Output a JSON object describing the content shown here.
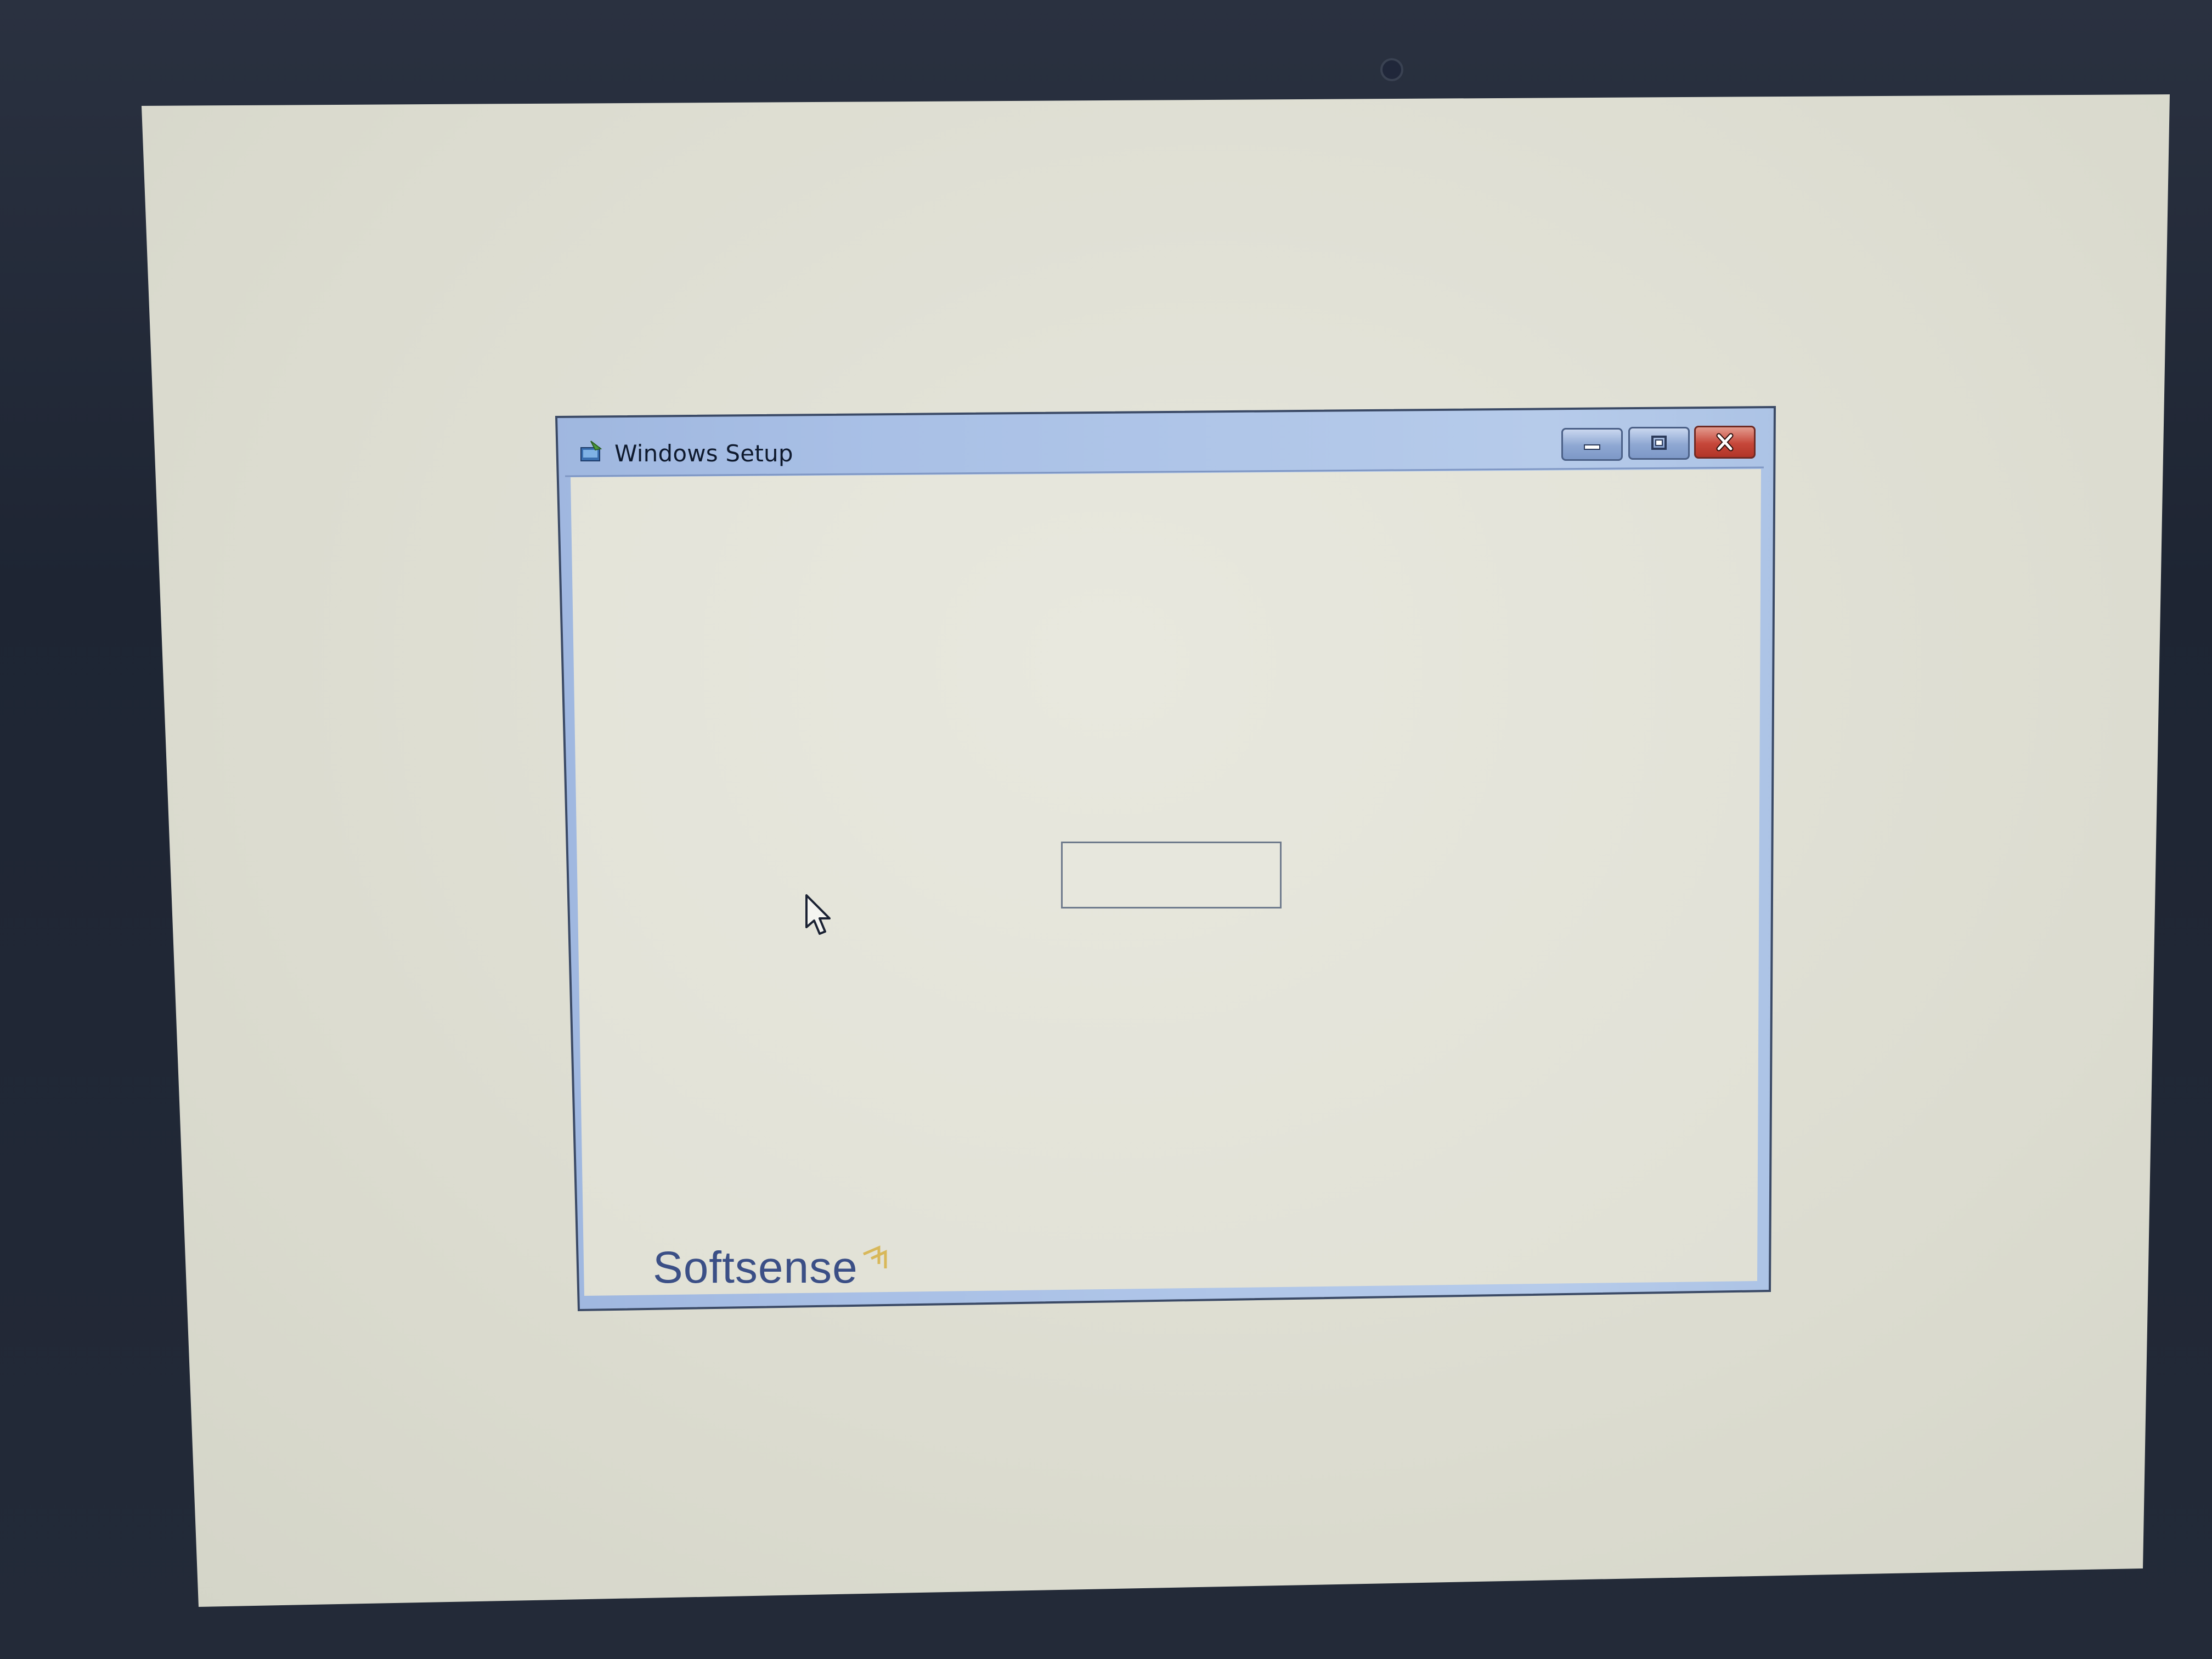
{
  "window": {
    "title": "Windows Setup",
    "icon": "setup-icon",
    "buttons": {
      "minimize": "minimize-icon",
      "maximize": "maximize-icon",
      "close": "close-icon"
    }
  },
  "branding": {
    "logo_text": "Softsense"
  },
  "colors": {
    "title_bar": "#9ab4dc",
    "close_button": "#c6473a",
    "logo_text": "#3b4f86",
    "logo_mark": "#d8b85a",
    "screen_background": "#e0e0d5"
  },
  "cursor": {
    "icon": "arrow-cursor-icon"
  }
}
